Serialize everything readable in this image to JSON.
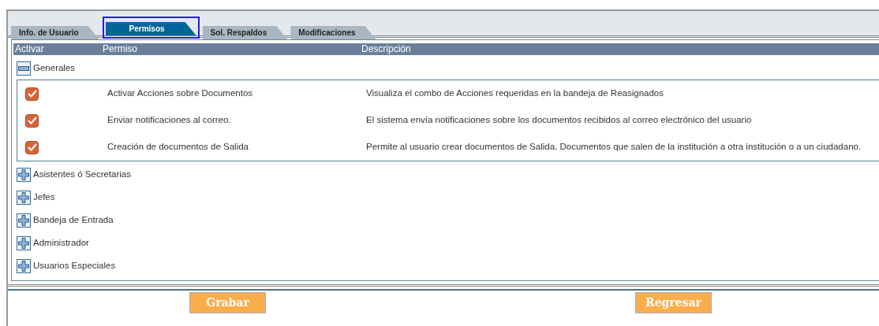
{
  "tabs": [
    {
      "label": "Info. de Usuario",
      "selected": false,
      "focused": false
    },
    {
      "label": "Permisos",
      "selected": true,
      "focused": true
    },
    {
      "label": "Sol. Respaldos",
      "selected": false,
      "focused": false
    },
    {
      "label": "Modificaciones",
      "selected": false,
      "focused": false
    }
  ],
  "table": {
    "columns": [
      "Activar",
      "Permiso",
      "Descripción"
    ],
    "groups": [
      {
        "label": "Generales",
        "expanded": true,
        "children": [
          {
            "permission": "Activar Acciones sobre Documentos",
            "description": "Visualiza el combo de Acciones requeridas en la bandeja de Reasignados",
            "checked": true
          },
          {
            "permission": "Enviar notificaciones al correo.",
            "description": "El sistema envía notificaciones sobre los documentos recibidos al correo electrónico del usuario",
            "checked": true
          },
          {
            "permission": "Creación de documentos de Salida",
            "description": "Permite al usuario crear documentos de Salida. Documentos que salen de la institución a otra institución o a un ciudadano.",
            "checked": true
          }
        ]
      },
      {
        "label": "Asistentes ó Secretarias",
        "expanded": false
      },
      {
        "label": "Jefes",
        "expanded": false
      },
      {
        "label": "Bandeja de Entrada",
        "expanded": false
      },
      {
        "label": "Administrador",
        "expanded": false
      },
      {
        "label": "Usuarios Especiales",
        "expanded": false
      }
    ]
  },
  "buttons": [
    "Grabar",
    "Regresar"
  ]
}
